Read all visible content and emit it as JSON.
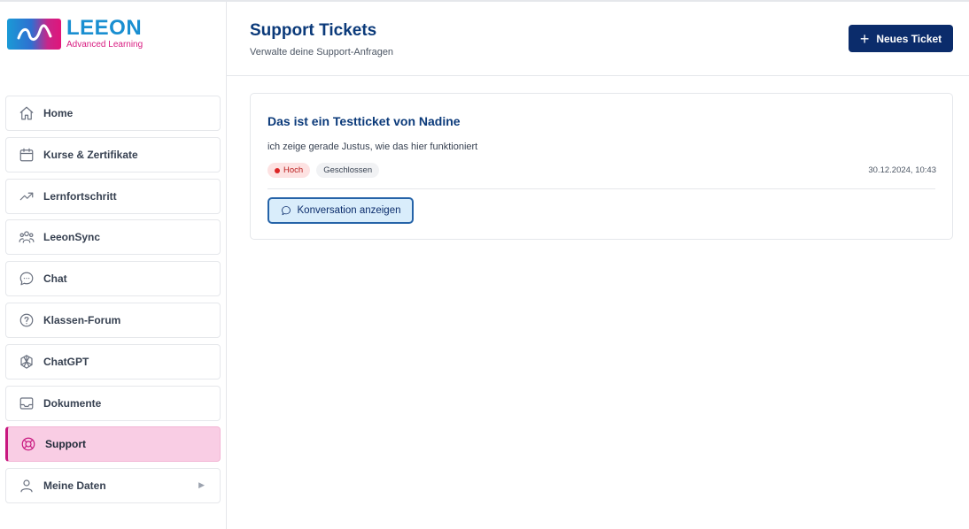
{
  "brand": {
    "title": "LEEON",
    "subtitle": "Advanced Learning"
  },
  "sidebar": {
    "items": [
      {
        "label": "Home",
        "icon": "home-icon"
      },
      {
        "label": "Kurse & Zertifikate",
        "icon": "calendar-icon"
      },
      {
        "label": "Lernfortschritt",
        "icon": "trending-up-icon"
      },
      {
        "label": "LeeonSync",
        "icon": "users-icon"
      },
      {
        "label": "Chat",
        "icon": "chat-bubble-icon"
      },
      {
        "label": "Klassen-Forum",
        "icon": "help-circle-icon"
      },
      {
        "label": "ChatGPT",
        "icon": "openai-icon"
      },
      {
        "label": "Dokumente",
        "icon": "inbox-icon"
      },
      {
        "label": "Support",
        "icon": "lifebuoy-icon",
        "active": true
      },
      {
        "label": "Meine Daten",
        "icon": "user-icon",
        "arrow": "▶"
      }
    ]
  },
  "header": {
    "title": "Support Tickets",
    "subtitle": "Verwalte deine Support-Anfragen",
    "new_button": "Neues Ticket"
  },
  "tickets": [
    {
      "title": "Das ist ein Testticket von Nadine",
      "description": "ich zeige gerade Justus, wie das hier funktioniert",
      "priority": "Hoch",
      "status": "Geschlossen",
      "date": "30.12.2024, 10:43",
      "action": "Konversation anzeigen"
    }
  ],
  "colors": {
    "primary": "#0b2c6b",
    "accent": "#c8177f",
    "active_bg": "#f9cde4",
    "priority_high": "#dc2626"
  }
}
